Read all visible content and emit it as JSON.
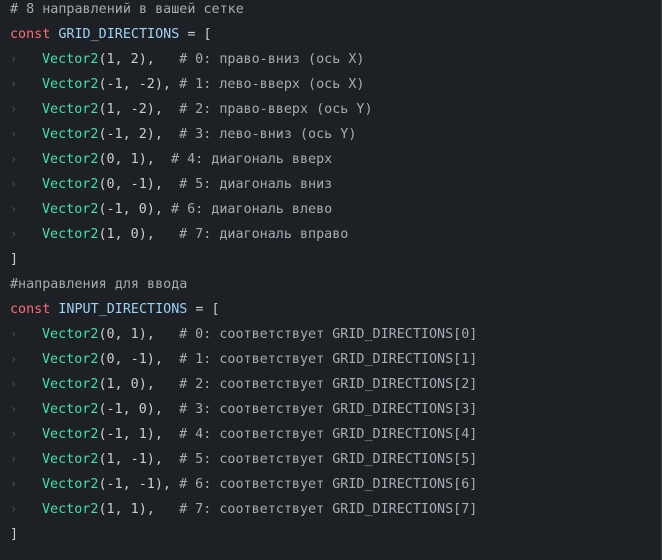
{
  "editor": {
    "lines": [
      {
        "type": "comment",
        "text": "# 8 направлений в вашей сетке"
      },
      {
        "type": "decl",
        "kw": "const",
        "name": "GRID_DIRECTIONS",
        "rest": " = ["
      },
      {
        "type": "item",
        "fn": "Vector2",
        "args": "(1, 2),",
        "pad": "   ",
        "comment": "# 0: право-вниз (ось X)"
      },
      {
        "type": "item",
        "fn": "Vector2",
        "args": "(-1, -2),",
        "pad": " ",
        "comment": "# 1: лево-вверх (ось X)"
      },
      {
        "type": "item",
        "fn": "Vector2",
        "args": "(1, -2),",
        "pad": "  ",
        "comment": "# 2: право-вверх (ось Y)"
      },
      {
        "type": "item",
        "fn": "Vector2",
        "args": "(-1, 2),",
        "pad": "  ",
        "comment": "# 3: лево-вниз (ось Y)"
      },
      {
        "type": "item",
        "fn": "Vector2",
        "args": "(0, 1),",
        "pad": "  ",
        "comment": "# 4: диагональ вверх"
      },
      {
        "type": "item",
        "fn": "Vector2",
        "args": "(0, -1),",
        "pad": "  ",
        "comment": "# 5: диагональ вниз"
      },
      {
        "type": "item",
        "fn": "Vector2",
        "args": "(-1, 0),",
        "pad": " ",
        "comment": "# 6: диагональ влево"
      },
      {
        "type": "item",
        "fn": "Vector2",
        "args": "(1, 0),",
        "pad": "   ",
        "comment": "# 7: диагональ вправо"
      },
      {
        "type": "close",
        "text": "]"
      },
      {
        "type": "comment",
        "text": "#направления для ввода"
      },
      {
        "type": "decl",
        "kw": "const",
        "name": "INPUT_DIRECTIONS",
        "rest": " = ["
      },
      {
        "type": "item",
        "fn": "Vector2",
        "args": "(0, 1),",
        "pad": "   ",
        "comment": "# 0: соответствует GRID_DIRECTIONS[0]"
      },
      {
        "type": "item",
        "fn": "Vector2",
        "args": "(0, -1),",
        "pad": "  ",
        "comment": "# 1: соответствует GRID_DIRECTIONS[1]"
      },
      {
        "type": "item",
        "fn": "Vector2",
        "args": "(1, 0),",
        "pad": "   ",
        "comment": "# 2: соответствует GRID_DIRECTIONS[2]"
      },
      {
        "type": "item",
        "fn": "Vector2",
        "args": "(-1, 0),",
        "pad": "  ",
        "comment": "# 3: соответствует GRID_DIRECTIONS[3]"
      },
      {
        "type": "item",
        "fn": "Vector2",
        "args": "(-1, 1),",
        "pad": "  ",
        "comment": "# 4: соответствует GRID_DIRECTIONS[4]"
      },
      {
        "type": "item",
        "fn": "Vector2",
        "args": "(1, -1),",
        "pad": "  ",
        "comment": "# 5: соответствует GRID_DIRECTIONS[5]"
      },
      {
        "type": "item",
        "fn": "Vector2",
        "args": "(-1, -1),",
        "pad": " ",
        "comment": "# 6: соответствует GRID_DIRECTIONS[6]"
      },
      {
        "type": "item",
        "fn": "Vector2",
        "args": "(1, 1),",
        "pad": "   ",
        "comment": "# 7: соответствует GRID_DIRECTIONS[7]"
      },
      {
        "type": "close",
        "text": "]"
      }
    ],
    "indent_glyph": "›",
    "colors": {
      "background": "#1d2024",
      "keyword": "#ff6b78",
      "constant": "#9dd1f5",
      "function": "#42e0b0",
      "comment": "#a7abb2",
      "plain": "#c9ccd1"
    }
  }
}
